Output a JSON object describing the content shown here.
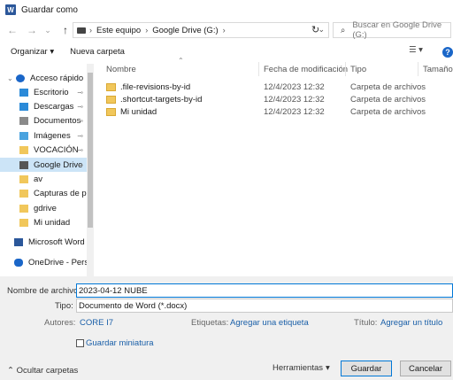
{
  "window": {
    "title": "Guardar como",
    "app_icon": "W"
  },
  "nav_buttons": {
    "back": "←",
    "forward": "→",
    "recent": "⌄",
    "up": "↑"
  },
  "address": {
    "crumbs": [
      "Este equipo",
      "Google Drive (G:)"
    ],
    "separator": "›",
    "dropdown": "⌄",
    "refresh": "↻"
  },
  "search": {
    "placeholder": "Buscar en Google Drive (G:)",
    "icon": "⌕"
  },
  "toolbar": {
    "organize": "Organizar ▾",
    "new_folder": "Nueva carpeta",
    "view": "☰ ▾",
    "help": "?"
  },
  "nav_pane": {
    "items": [
      {
        "label": "Acceso rápido",
        "icon": "star-icon",
        "color": "#1a66c8",
        "pinned": false
      },
      {
        "label": "Escritorio",
        "icon": "desktop-icon",
        "color": "#2b8ad8",
        "pinned": true
      },
      {
        "label": "Descargas",
        "icon": "download-icon",
        "color": "#2b8ad8",
        "pinned": true
      },
      {
        "label": "Documentos",
        "icon": "documents-icon",
        "color": "#8a8a8a",
        "pinned": true
      },
      {
        "label": "Imágenes",
        "icon": "pictures-icon",
        "color": "#4aa3df",
        "pinned": true
      },
      {
        "label": "VOCACIÓN",
        "icon": "folder-icon",
        "color": "#f1c75b",
        "pinned": true
      },
      {
        "label": "Google Drive",
        "icon": "drive-icon",
        "color": "#555555",
        "pinned": true
      },
      {
        "label": "av",
        "icon": "folder-icon",
        "color": "#f1c75b",
        "pinned": false
      },
      {
        "label": "Capturas de pan",
        "icon": "folder-icon",
        "color": "#f1c75b",
        "pinned": false
      },
      {
        "label": "gdrive",
        "icon": "folder-icon",
        "color": "#f1c75b",
        "pinned": false
      },
      {
        "label": "Mi unidad",
        "icon": "folder-icon",
        "color": "#f1c75b",
        "pinned": false
      },
      {
        "label": "Microsoft Word",
        "icon": "word-icon",
        "color": "#2b579a",
        "pinned": false
      },
      {
        "label": "OneDrive - Persor",
        "icon": "onedrive-icon",
        "color": "#1a66c8",
        "pinned": false
      }
    ],
    "pin_glyph": "⊸"
  },
  "columns": {
    "name": "Nombre",
    "modified": "Fecha de modificación",
    "type": "Tipo",
    "size": "Tamaño"
  },
  "files": [
    {
      "name": ".file-revisions-by-id",
      "modified": "12/4/2023 12:32",
      "type": "Carpeta de archivos"
    },
    {
      "name": ".shortcut-targets-by-id",
      "modified": "12/4/2023 12:32",
      "type": "Carpeta de archivos"
    },
    {
      "name": "Mi unidad",
      "modified": "12/4/2023 12:32",
      "type": "Carpeta de archivos"
    }
  ],
  "form": {
    "filename_label": "Nombre de archivo:",
    "filename_value": "2023-04-12 NUBE",
    "type_label": "Tipo:",
    "type_value": "Documento de Word (*.docx)",
    "authors_label": "Autores:",
    "authors_value": "CORE I7",
    "tags_label": "Etiquetas:",
    "tags_value": "Agregar una etiqueta",
    "title_label": "Título:",
    "title_value": "Agregar un título",
    "thumbnail_label": "Guardar miniatura"
  },
  "footer": {
    "hide_folders": "⌃ Ocultar carpetas",
    "tools": "Herramientas",
    "tools_arrow": "▾",
    "save": "Guardar",
    "cancel": "Cancelar"
  }
}
